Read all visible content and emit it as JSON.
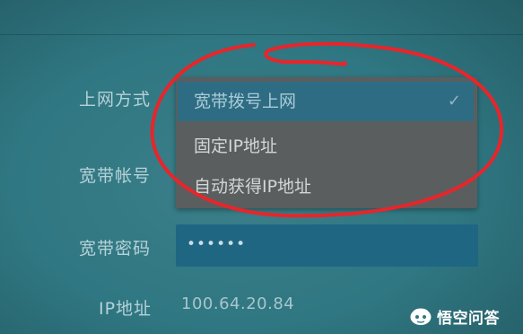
{
  "form": {
    "connection_type_label": "上网方式",
    "account_label": "宽带帐号",
    "password_label": "宽带密码",
    "password_value": "••••••",
    "ip_label": "IP地址",
    "ip_value": "100.64.20.84"
  },
  "dropdown": {
    "options": [
      {
        "label": "宽带拨号上网",
        "selected": true
      },
      {
        "label": "固定IP地址",
        "selected": false
      },
      {
        "label": "自动获得IP地址",
        "selected": false
      }
    ],
    "check_icon": "✓"
  },
  "watermark": {
    "text": "悟空问答",
    "icon": "wukong-logo"
  },
  "colors": {
    "background": "#2f7782",
    "annotation": "#e8252a",
    "selected_option": "#2e6c83"
  }
}
